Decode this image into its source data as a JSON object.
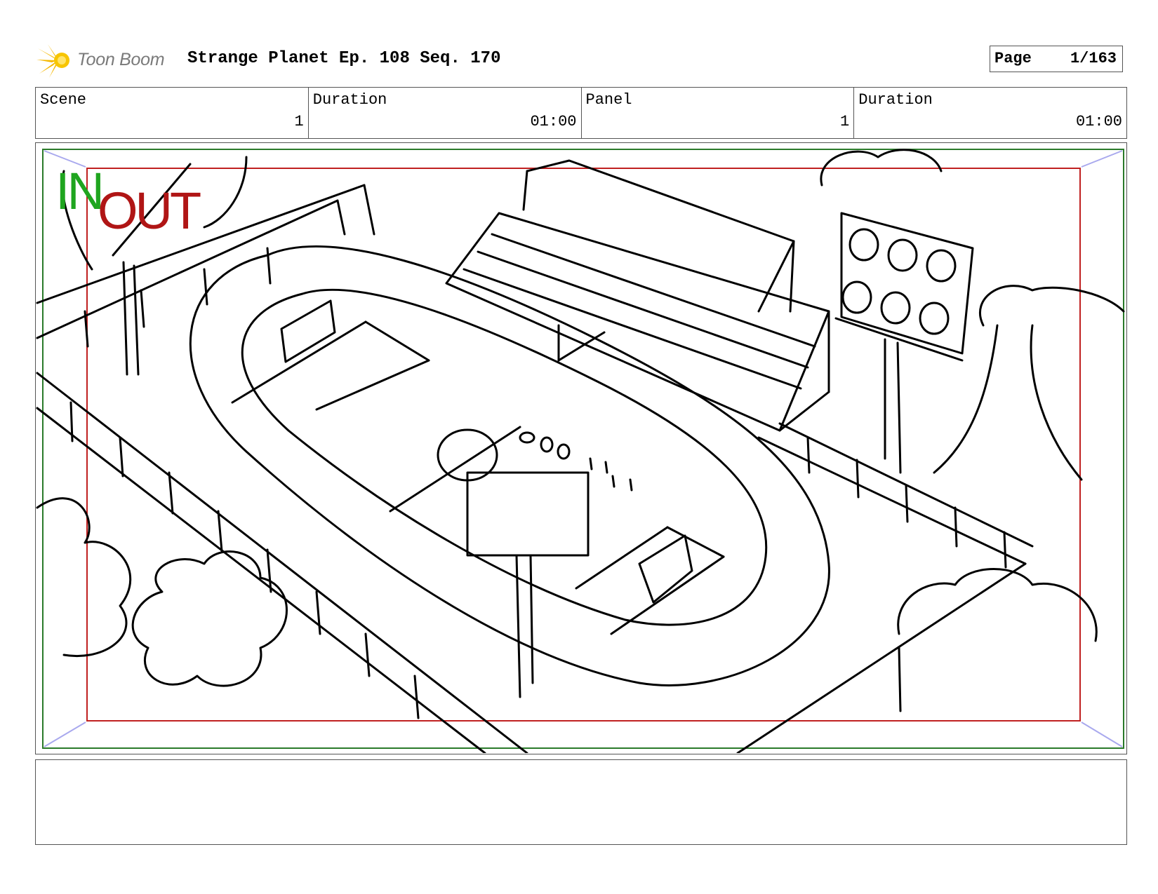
{
  "header": {
    "logo_text": "Toon Boom",
    "title": "Strange Planet Ep. 108 Seq. 170",
    "page_label": "Page",
    "page_number": "1/163"
  },
  "info": {
    "scene_label": "Scene",
    "scene_value": "1",
    "scene_duration_label": "Duration",
    "scene_duration_value": "01:00",
    "panel_label": "Panel",
    "panel_value": "1",
    "panel_duration_label": "Duration",
    "panel_duration_value": "01:00"
  },
  "frame": {
    "in_label": "IN",
    "out_label": "OUT",
    "in_color": "#1fa51f",
    "out_color": "#b01515",
    "sketch_subject": "stadium-track-sketch"
  },
  "notes": {
    "text": ""
  }
}
